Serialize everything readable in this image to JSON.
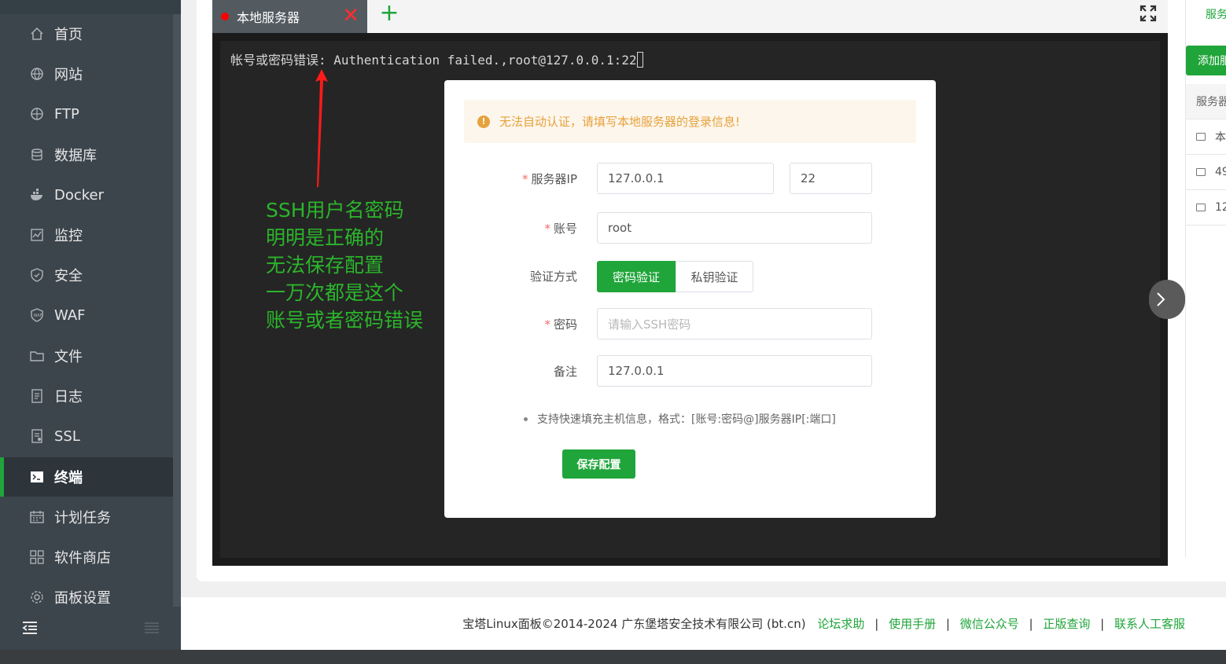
{
  "sidebar": {
    "items": [
      {
        "label": "首页",
        "icon": "home-icon"
      },
      {
        "label": "网站",
        "icon": "globe-icon"
      },
      {
        "label": "FTP",
        "icon": "ftp-globe-icon"
      },
      {
        "label": "数据库",
        "icon": "database-icon"
      },
      {
        "label": "Docker",
        "icon": "docker-icon"
      },
      {
        "label": "监控",
        "icon": "monitor-chart-icon"
      },
      {
        "label": "安全",
        "icon": "shield-icon"
      },
      {
        "label": "WAF",
        "icon": "waf-shield-icon"
      },
      {
        "label": "文件",
        "icon": "folder-icon"
      },
      {
        "label": "日志",
        "icon": "log-icon"
      },
      {
        "label": "SSL",
        "icon": "ssl-icon"
      },
      {
        "label": "终端",
        "icon": "terminal-icon",
        "active": true
      },
      {
        "label": "计划任务",
        "icon": "calendar-icon"
      },
      {
        "label": "软件商店",
        "icon": "grid-icon"
      },
      {
        "label": "面板设置",
        "icon": "gear-icon"
      }
    ]
  },
  "terminal": {
    "tab_label": "本地服务器",
    "close_glyph": "✕",
    "add_glyph": "+",
    "output_line": "帐号或密码错误: Authentication failed.,root@127.0.0.1:22"
  },
  "annotation": {
    "lines": [
      "SSH用户名密码",
      "明明是正确的",
      "无法保存配置",
      "一万次都是这个",
      "账号或者密码错误"
    ]
  },
  "dialog": {
    "alert_text": "无法自动认证，请填写本地服务器的登录信息!",
    "server_ip_label": "服务器IP",
    "server_ip_value": "127.0.0.1",
    "port_value": "22",
    "account_label": "账号",
    "account_value": "root",
    "auth_method_label": "验证方式",
    "auth_password_label": "密码验证",
    "auth_key_label": "私钥验证",
    "password_label": "密码",
    "password_placeholder": "请输入SSH密码",
    "remark_label": "备注",
    "remark_value": "127.0.0.1",
    "tip_text": "支持快速填充主机信息，格式：[账号:密码@]服务器IP[:端口]",
    "save_label": "保存配置"
  },
  "right_panel": {
    "tab_label": "服务",
    "add_label": "添加服",
    "header_label": "服务器",
    "rows": [
      "本",
      "49",
      "12"
    ]
  },
  "footer": {
    "copyright": "宝塔Linux面板©2014-2024 广东堡塔安全技术有限公司 (bt.cn)",
    "links": [
      "论坛求助",
      "使用手册",
      "微信公众号",
      "正版查询",
      "联系人工客服"
    ],
    "separator": "|"
  },
  "colors": {
    "accent": "#20a53a",
    "sidebar_bg": "#3c454c",
    "warning": "#e6a23c",
    "error_red": "#ff0000"
  }
}
